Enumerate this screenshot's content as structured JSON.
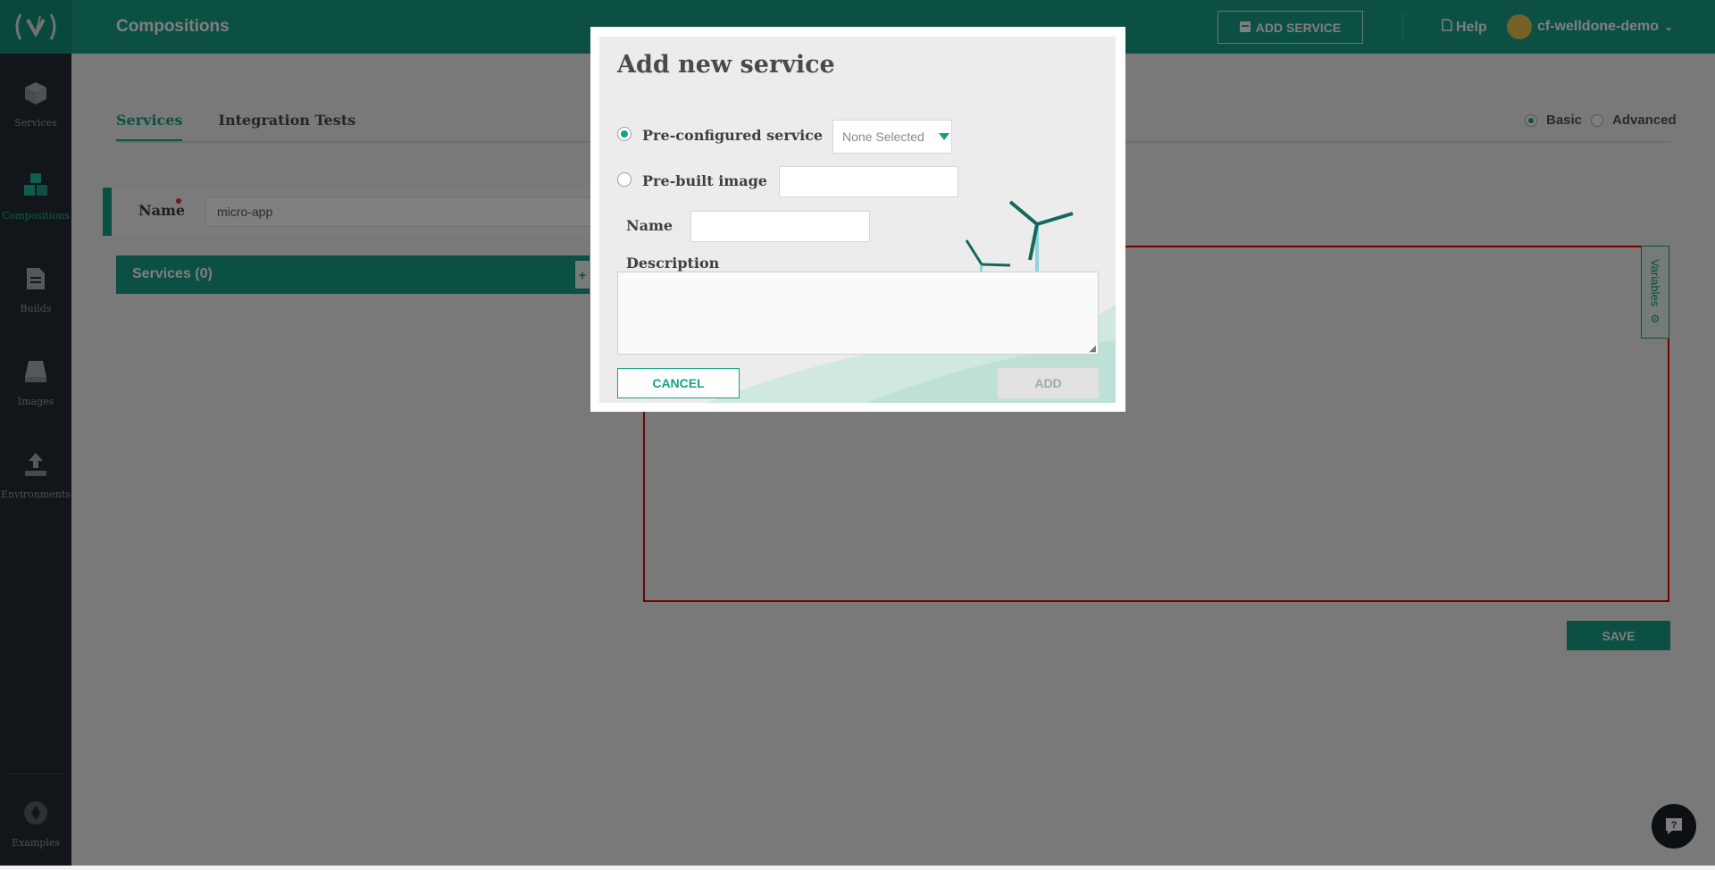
{
  "sidebar": {
    "items": [
      {
        "label": "Services",
        "icon": "cube-icon"
      },
      {
        "label": "Compositions",
        "icon": "cubes-icon"
      },
      {
        "label": "Builds",
        "icon": "document-icon"
      },
      {
        "label": "Images",
        "icon": "drive-icon"
      },
      {
        "label": "Environments",
        "icon": "upload-icon"
      }
    ],
    "examples_label": "Examples"
  },
  "header": {
    "title": "Compositions",
    "add_service_label": "ADD SERVICE",
    "help_label": "Help",
    "user": "cf-welldone-demo"
  },
  "main": {
    "tabs": [
      {
        "label": "Services"
      },
      {
        "label": "Integration Tests"
      }
    ],
    "mode": {
      "basic": "Basic",
      "advanced": "Advanced",
      "selected": "Basic"
    },
    "name_label": "Name",
    "name_value": "micro-app",
    "services_title": "Services (0)",
    "variables_label": "Variables",
    "save_label": "SAVE"
  },
  "modal": {
    "title": "Add new service",
    "preconfigured_label": "Pre-configured service",
    "preconfigured_selected": "None Selected",
    "prebuilt_label": "Pre-built image",
    "name_label": "Name",
    "description_label": "Description",
    "cancel_label": "CANCEL",
    "add_label": "ADD"
  },
  "colors": {
    "accent": "#17a184",
    "sidebar": "#242b33",
    "required": "#d9333b",
    "canvas_border": "#e50000"
  }
}
